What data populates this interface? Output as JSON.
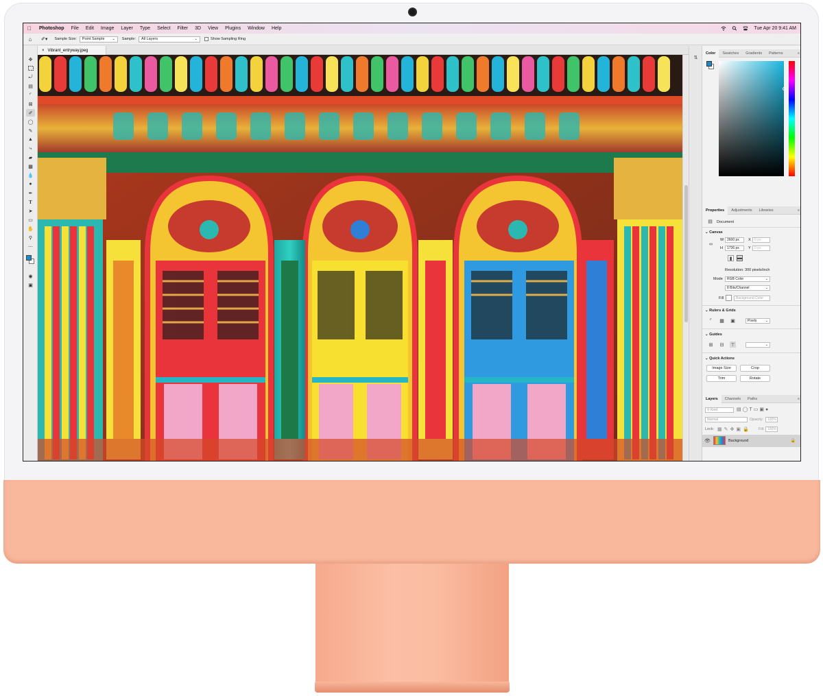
{
  "menubar": {
    "app_name": "Photoshop",
    "items": [
      "File",
      "Edit",
      "Image",
      "Layer",
      "Type",
      "Select",
      "Filter",
      "3D",
      "View",
      "Plugins",
      "Window",
      "Help"
    ],
    "clock": "Tue Apr 20  9:41 AM"
  },
  "options": {
    "sample_size_label": "Sample Size:",
    "sample_size_value": "Point Sample",
    "sample_label": "Sample:",
    "sample_value": "All Layers",
    "show_ring_label": "Show Sampling Ring"
  },
  "document": {
    "tab_name": "Vibrant_entryway.jpeg",
    "close_glyph": "×"
  },
  "color_panel": {
    "tabs": [
      "Color",
      "Swatches",
      "Gradients",
      "Patterns"
    ],
    "foreground": "#1e88c8",
    "hue_base": "#19b7e0"
  },
  "properties": {
    "tabs": [
      "Properties",
      "Adjustments",
      "Libraries"
    ],
    "doc_label": "Document",
    "canvas_title": "Canvas",
    "w_label": "W",
    "w_value": "2600 px",
    "h_label": "H",
    "h_value": "1736 px",
    "x_label": "X",
    "x_value": "0 px",
    "y_label": "Y",
    "y_value": "0 px",
    "resolution": "Resolution: 300 pixels/inch",
    "mode_label": "Mode",
    "mode_value": "RGB Color",
    "depth_value": "8 Bits/Channel",
    "fill_label": "Fill",
    "fill_value": "Background Color",
    "rulers_title": "Rulers & Grids",
    "units_value": "Pixels",
    "guides_title": "Guides",
    "quick_title": "Quick Actions",
    "btn_image_size": "Image Size",
    "btn_crop": "Crop",
    "btn_trim": "Trim",
    "btn_rotate": "Rotate"
  },
  "layers": {
    "tabs": [
      "Layers",
      "Channels",
      "Paths"
    ],
    "kind_value": "Kind",
    "blend_value": "Normal",
    "opacity_label": "Opacity:",
    "opacity_value": "100%",
    "lock_label": "Lock:",
    "fill_label": "Fill:",
    "fill_value": "100%",
    "layer_name": "Background"
  }
}
